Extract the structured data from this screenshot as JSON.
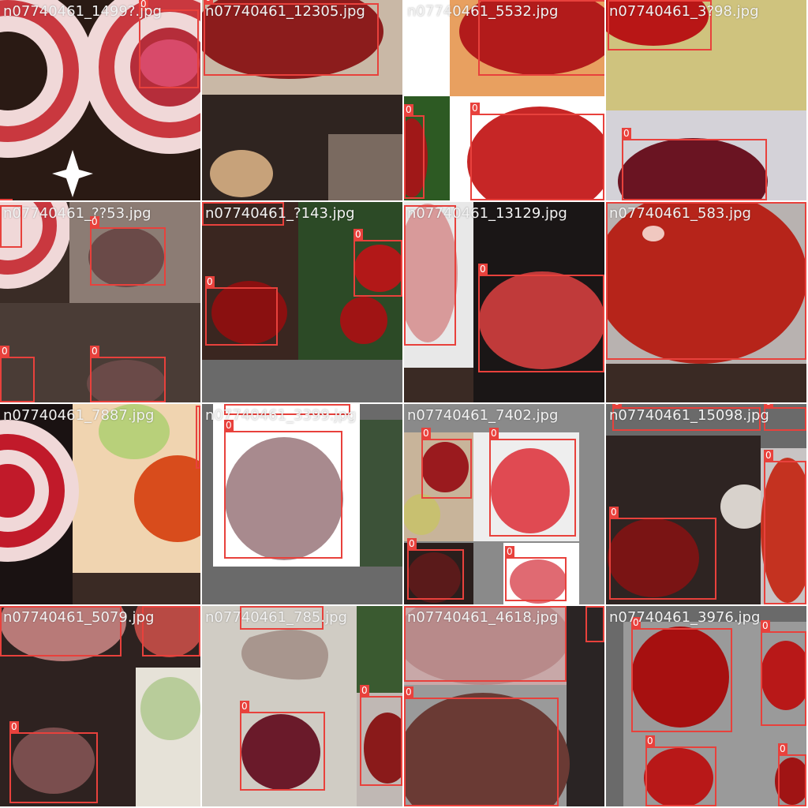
{
  "image_size": "1024x1024",
  "box_class_label": "0",
  "colors": {
    "box": "#e8413c",
    "title_text": "#f2f2f2",
    "pad_gray": "#737373"
  },
  "tiles": [
    {
      "title": "n07740461_1499?.jpg"
    },
    {
      "title": "n07740461_12305.jpg"
    },
    {
      "title": "n07740461_5532.jpg"
    },
    {
      "title": "n07740461_3?98.jpg"
    },
    {
      "title": "n07740461_??53.jpg"
    },
    {
      "title": "n07740461_?143.jpg"
    },
    {
      "title": "n07740461_13129.jpg"
    },
    {
      "title": "n07740461_583.jpg"
    },
    {
      "title": "n07740461_7887.jpg"
    },
    {
      "title": "n07740461_3399.jpg"
    },
    {
      "title": "n07740461_7402.jpg"
    },
    {
      "title": "n07740461_15098.jpg"
    },
    {
      "title": "n07740461_5079.jpg"
    },
    {
      "title": "n07740461_785.jpg"
    },
    {
      "title": "n07740461_4618.jpg"
    },
    {
      "title": "n07740461_3976.jpg"
    }
  ]
}
